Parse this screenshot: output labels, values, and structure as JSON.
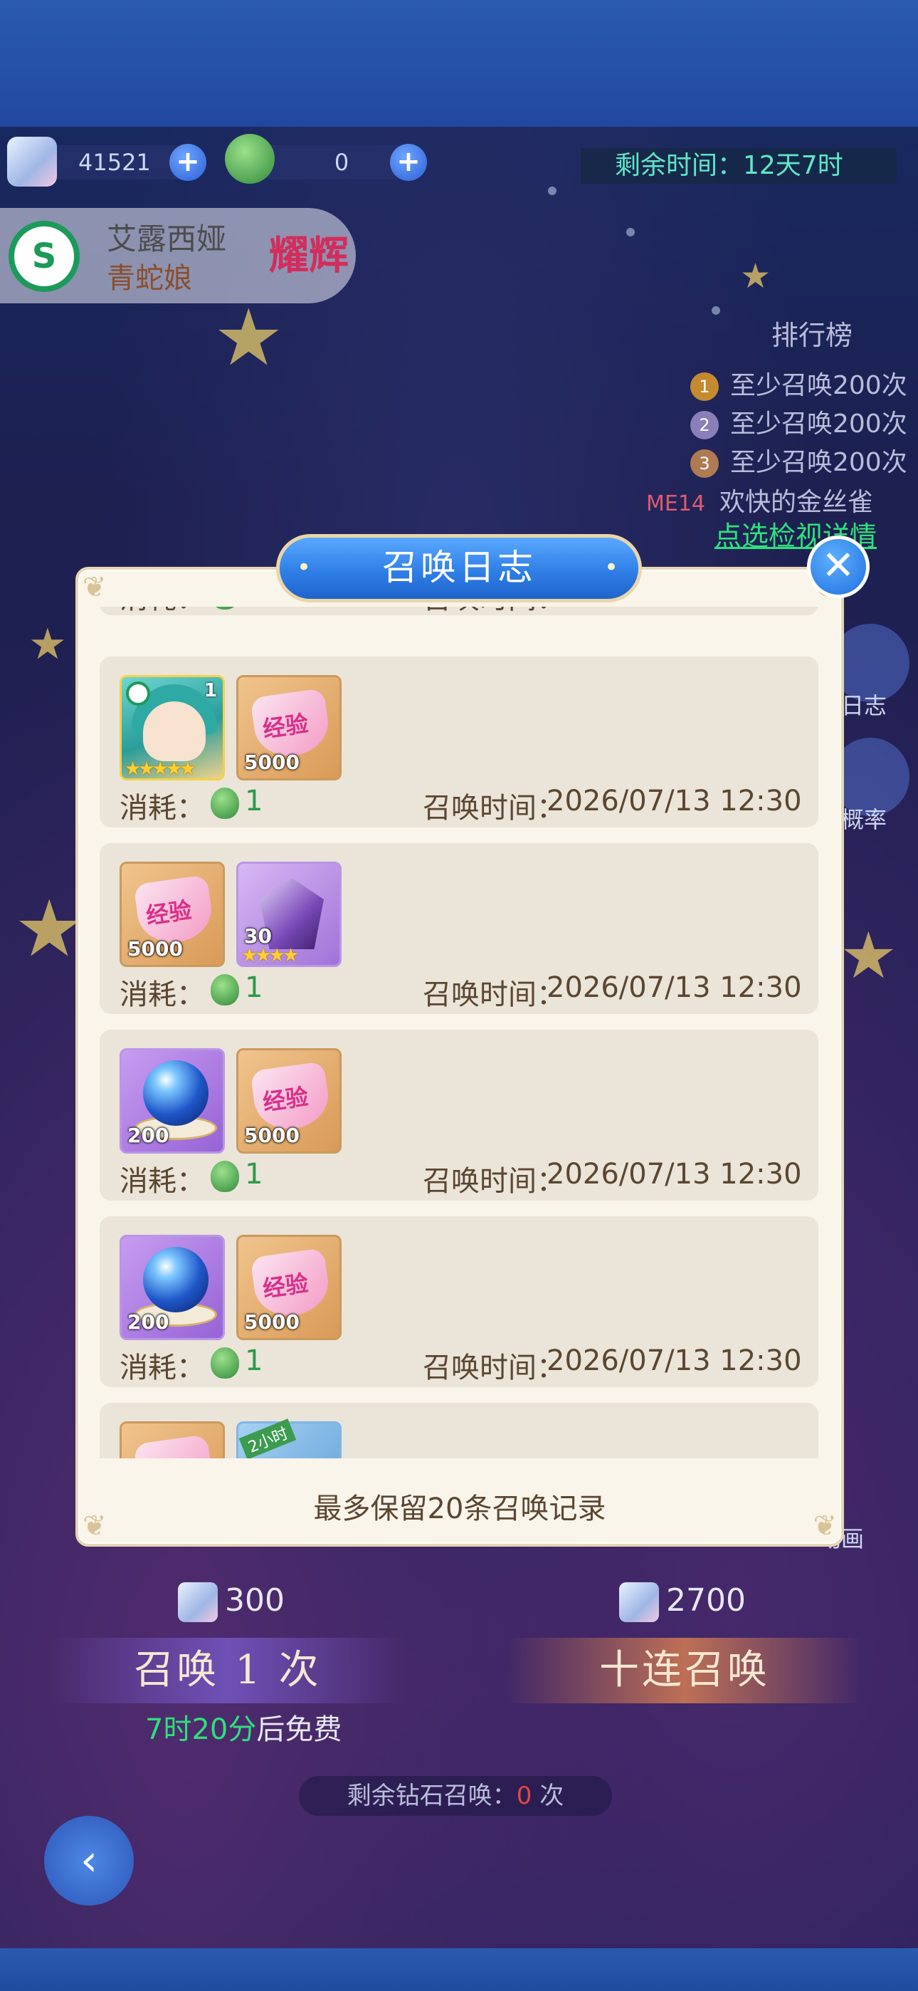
{
  "resources": {
    "diamond_count": "41521",
    "hop_count": "0"
  },
  "timer": {
    "text": "剩余时间：12天7时"
  },
  "character": {
    "name": "艾露西娅",
    "subtitle": "青蛇娘",
    "badge": "耀辉"
  },
  "leaderboard": {
    "title": "排行榜",
    "entries": [
      {
        "rank": "1",
        "text": "至少召唤200次"
      },
      {
        "rank": "2",
        "text": "至少召唤200次"
      },
      {
        "rank": "3",
        "text": "至少召唤200次"
      }
    ],
    "me_rank": "ME14",
    "me_name": "欢快的金丝雀",
    "link": "点选检视详情"
  },
  "side": {
    "log_label": "日志",
    "rate_label": "概率",
    "anim_label": "动画"
  },
  "pull": {
    "single_cost": "300",
    "ten_cost": "2700",
    "single_label": "召唤 1 次",
    "ten_label": "十连召唤",
    "free_time": "7时20分",
    "free_suffix": "后免费",
    "remaining_prefix": "剩余钻石召唤：",
    "remaining_count": "0",
    "remaining_suffix": "次"
  },
  "modal": {
    "title": "召唤日志",
    "footer": "最多保留20条召唤记录",
    "cost_label": "消耗：",
    "time_label": "召唤时间：",
    "records": [
      {
        "cost": "1",
        "time": "2026/07/13 12:30",
        "items": [
          {
            "kind": "card",
            "count": "1",
            "stars": 5
          },
          {
            "kind": "exp",
            "count": "5000"
          }
        ]
      },
      {
        "cost": "1",
        "time": "2026/07/13 12:30",
        "items": [
          {
            "kind": "exp",
            "count": "5000"
          },
          {
            "kind": "purple",
            "count": "30",
            "stars": 4
          }
        ]
      },
      {
        "cost": "1",
        "time": "2026/07/13 12:30",
        "items": [
          {
            "kind": "orb",
            "count": "200"
          },
          {
            "kind": "exp",
            "count": "5000"
          }
        ]
      },
      {
        "cost": "1",
        "time": "2026/07/13 12:30",
        "items": [
          {
            "kind": "orb",
            "count": "200"
          },
          {
            "kind": "exp",
            "count": "5000"
          }
        ]
      },
      {
        "items": [
          {
            "kind": "exp",
            "count": ""
          },
          {
            "kind": "blue",
            "ribbon": "2小时"
          }
        ]
      }
    ],
    "exp_text": "经验"
  },
  "colors": {
    "accent_blue": "#2f7fe6",
    "panel_bg": "#faf5ea",
    "record_bg": "#ebe4d8",
    "green_value": "#2a9a4a",
    "timer_green": "#5fe7c6"
  }
}
